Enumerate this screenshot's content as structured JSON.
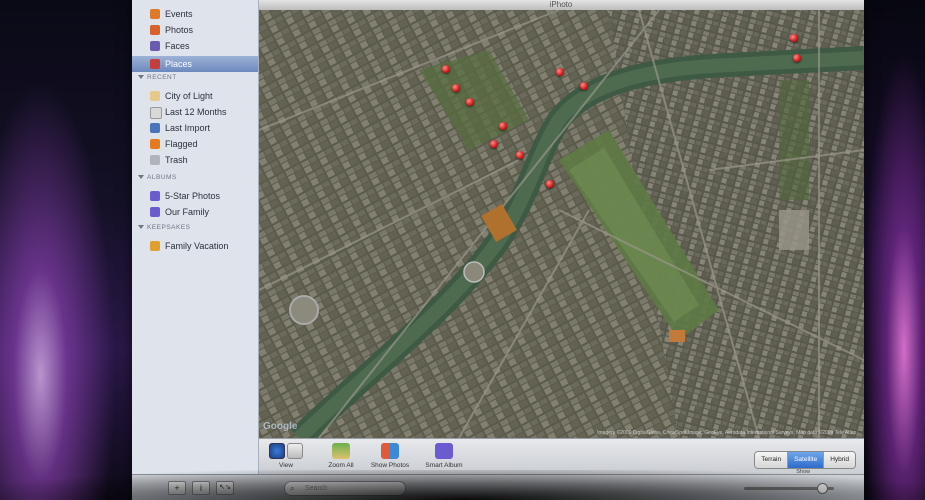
{
  "window": {
    "title": "iPhoto"
  },
  "sidebar": {
    "library": [
      {
        "label": "Events",
        "icon": "events-icon",
        "color": "#e07a2a",
        "selected": false
      },
      {
        "label": "Photos",
        "icon": "photos-icon",
        "color": "#d9612a",
        "selected": false
      },
      {
        "label": "Faces",
        "icon": "faces-icon",
        "color": "#6b5bb0",
        "selected": false
      },
      {
        "label": "Places",
        "icon": "places-icon",
        "color": "#c73c3c",
        "selected": true
      }
    ],
    "recent_header": "RECENT",
    "recent": [
      {
        "label": "City of Light",
        "icon": "event-icon",
        "color": "#e6c98a"
      },
      {
        "label": "Last 12 Months",
        "icon": "calendar-icon",
        "color": "#d9d9d9"
      },
      {
        "label": "Last Import",
        "icon": "import-icon",
        "color": "#4a74b8"
      },
      {
        "label": "Flagged",
        "icon": "flag-icon",
        "color": "#e87a1e"
      },
      {
        "label": "Trash",
        "icon": "trash-icon",
        "color": "#b0b4ba"
      }
    ],
    "albums_header": "ALBUMS",
    "albums": [
      {
        "label": "5-Star Photos",
        "icon": "smart-album-icon",
        "color": "#6a5bd0"
      },
      {
        "label": "Our Family",
        "icon": "album-icon",
        "color": "#6a5bd0"
      }
    ],
    "keepsakes_header": "KEEPSAKES",
    "keepsakes": [
      {
        "label": "Family Vacation",
        "icon": "book-icon",
        "color": "#e0a030"
      }
    ]
  },
  "map": {
    "provider_logo": "Google",
    "copyright": "Imagery ©2009 DigitalGlobe, Cnes/Spot Image, GeoEye, Aerodata International Surveys, Map data ©2009 Tele Atlas"
  },
  "toolbar": {
    "view_label": "View",
    "zoom_all_label": "Zoom All",
    "show_photos_label": "Show Photos",
    "smart_album_label": "Smart Album",
    "map_types": [
      "Terrain",
      "Satellite",
      "Hybrid"
    ],
    "map_type_selected": "Satellite",
    "map_type_caption": "Show"
  },
  "footer": {
    "add_label": "+",
    "info_label": "i",
    "fullscreen_label": "↖↘",
    "search_placeholder": "Search"
  },
  "colors": {
    "selection": "#6c88bd",
    "pin": "#d11a1a",
    "segment_active": "#2e6bcc"
  }
}
